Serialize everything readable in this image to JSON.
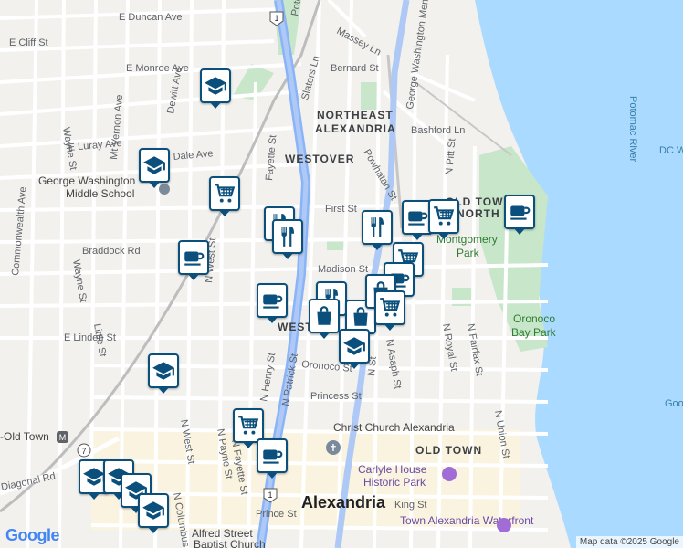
{
  "colors": {
    "water": "#aadaff",
    "park": "#c8e6c9",
    "road": "#ffffff",
    "highway": "#8ab4f8",
    "pin_border": "#0b4f7c",
    "rail": "#bdbdbd"
  },
  "streets": [
    "E Duncan Ave",
    "E Cliff St",
    "Massey Ln",
    "Potomac Ave",
    "Slaters Ln",
    "Bernard St",
    "E Monroe Ave",
    "George Washington Memorial Pkwy",
    "Mt Vernon Ave",
    "Dewitt Ave",
    "Wayne St",
    "E Luray Ave",
    "Dale Ave",
    "Commonwealth Ave",
    "Braddock Rd",
    "N West St",
    "Little St",
    "Wayne St",
    "E Linden St",
    "Bashford Ln",
    "First St",
    "Powhatan St",
    "N Pitt St",
    "Madison St",
    "N Henry St",
    "N Patrick St",
    "Oronoco St",
    "Princess St",
    "N Asaph St",
    "N Royal St",
    "N Fairfax St",
    "N Union St",
    "N Payne St",
    "N Fayette St",
    "N West St",
    "King St",
    "Prince St",
    "Diagonal Rd",
    "N Columbus St",
    "Fayette St",
    "N Alfred St",
    "N St"
  ],
  "neighborhoods": [
    "NORTHEAST",
    "ALEXANDRIA",
    "WESTOVER",
    "OLD TOWN",
    "NORTH",
    "OLD TOWN",
    "WEST"
  ],
  "pois": {
    "gw_middle_school": "George Washington\nMiddle School",
    "christ_church": "Christ Church Alexandria",
    "carlyle_house": "Carlyle House\nHistoric Park",
    "alfred_baptist": "Alfred Street\nBaptist Church",
    "waterfront": "Town Alexandria Waterfront",
    "king_st_station": "-Old Town"
  },
  "parks": [
    "Montgomery\nPark",
    "Oronoco\nBay Park"
  ],
  "water_labels": {
    "river": "Potomac River",
    "dc": "DC W",
    "goo": "Goo"
  },
  "city": "Alexandria",
  "route_shields": [
    "1",
    "1",
    "7"
  ],
  "attribution": "Map data ©2025 Google",
  "logo": "Google",
  "markers": [
    {
      "type": "school-icon",
      "label": "school"
    },
    {
      "type": "school-icon",
      "label": "school"
    },
    {
      "type": "shopping-cart-icon",
      "label": "grocery"
    },
    {
      "type": "restaurant-icon",
      "label": "restaurant"
    },
    {
      "type": "restaurant-icon",
      "label": "restaurant"
    },
    {
      "type": "cafe-icon",
      "label": "cafe"
    },
    {
      "type": "cafe-icon",
      "label": "cafe"
    },
    {
      "type": "restaurant-icon",
      "label": "restaurant"
    },
    {
      "type": "cafe-icon",
      "label": "cafe"
    },
    {
      "type": "shopping-cart-icon",
      "label": "grocery"
    },
    {
      "type": "cafe-icon",
      "label": "cafe"
    },
    {
      "type": "shopping-cart-icon",
      "label": "grocery"
    },
    {
      "type": "cafe-icon",
      "label": "cafe"
    },
    {
      "type": "restaurant-icon",
      "label": "restaurant"
    },
    {
      "type": "shopping-bag-icon",
      "label": "shop"
    },
    {
      "type": "shopping-bag-icon",
      "label": "shop"
    },
    {
      "type": "shopping-bag-icon",
      "label": "shop"
    },
    {
      "type": "shopping-cart-icon",
      "label": "grocery"
    },
    {
      "type": "school-icon",
      "label": "school"
    },
    {
      "type": "school-icon",
      "label": "school"
    },
    {
      "type": "shopping-cart-icon",
      "label": "grocery"
    },
    {
      "type": "cafe-icon",
      "label": "cafe"
    },
    {
      "type": "school-icon",
      "label": "school"
    },
    {
      "type": "school-icon",
      "label": "school"
    },
    {
      "type": "school-icon",
      "label": "school"
    },
    {
      "type": "school-icon",
      "label": "school"
    }
  ]
}
